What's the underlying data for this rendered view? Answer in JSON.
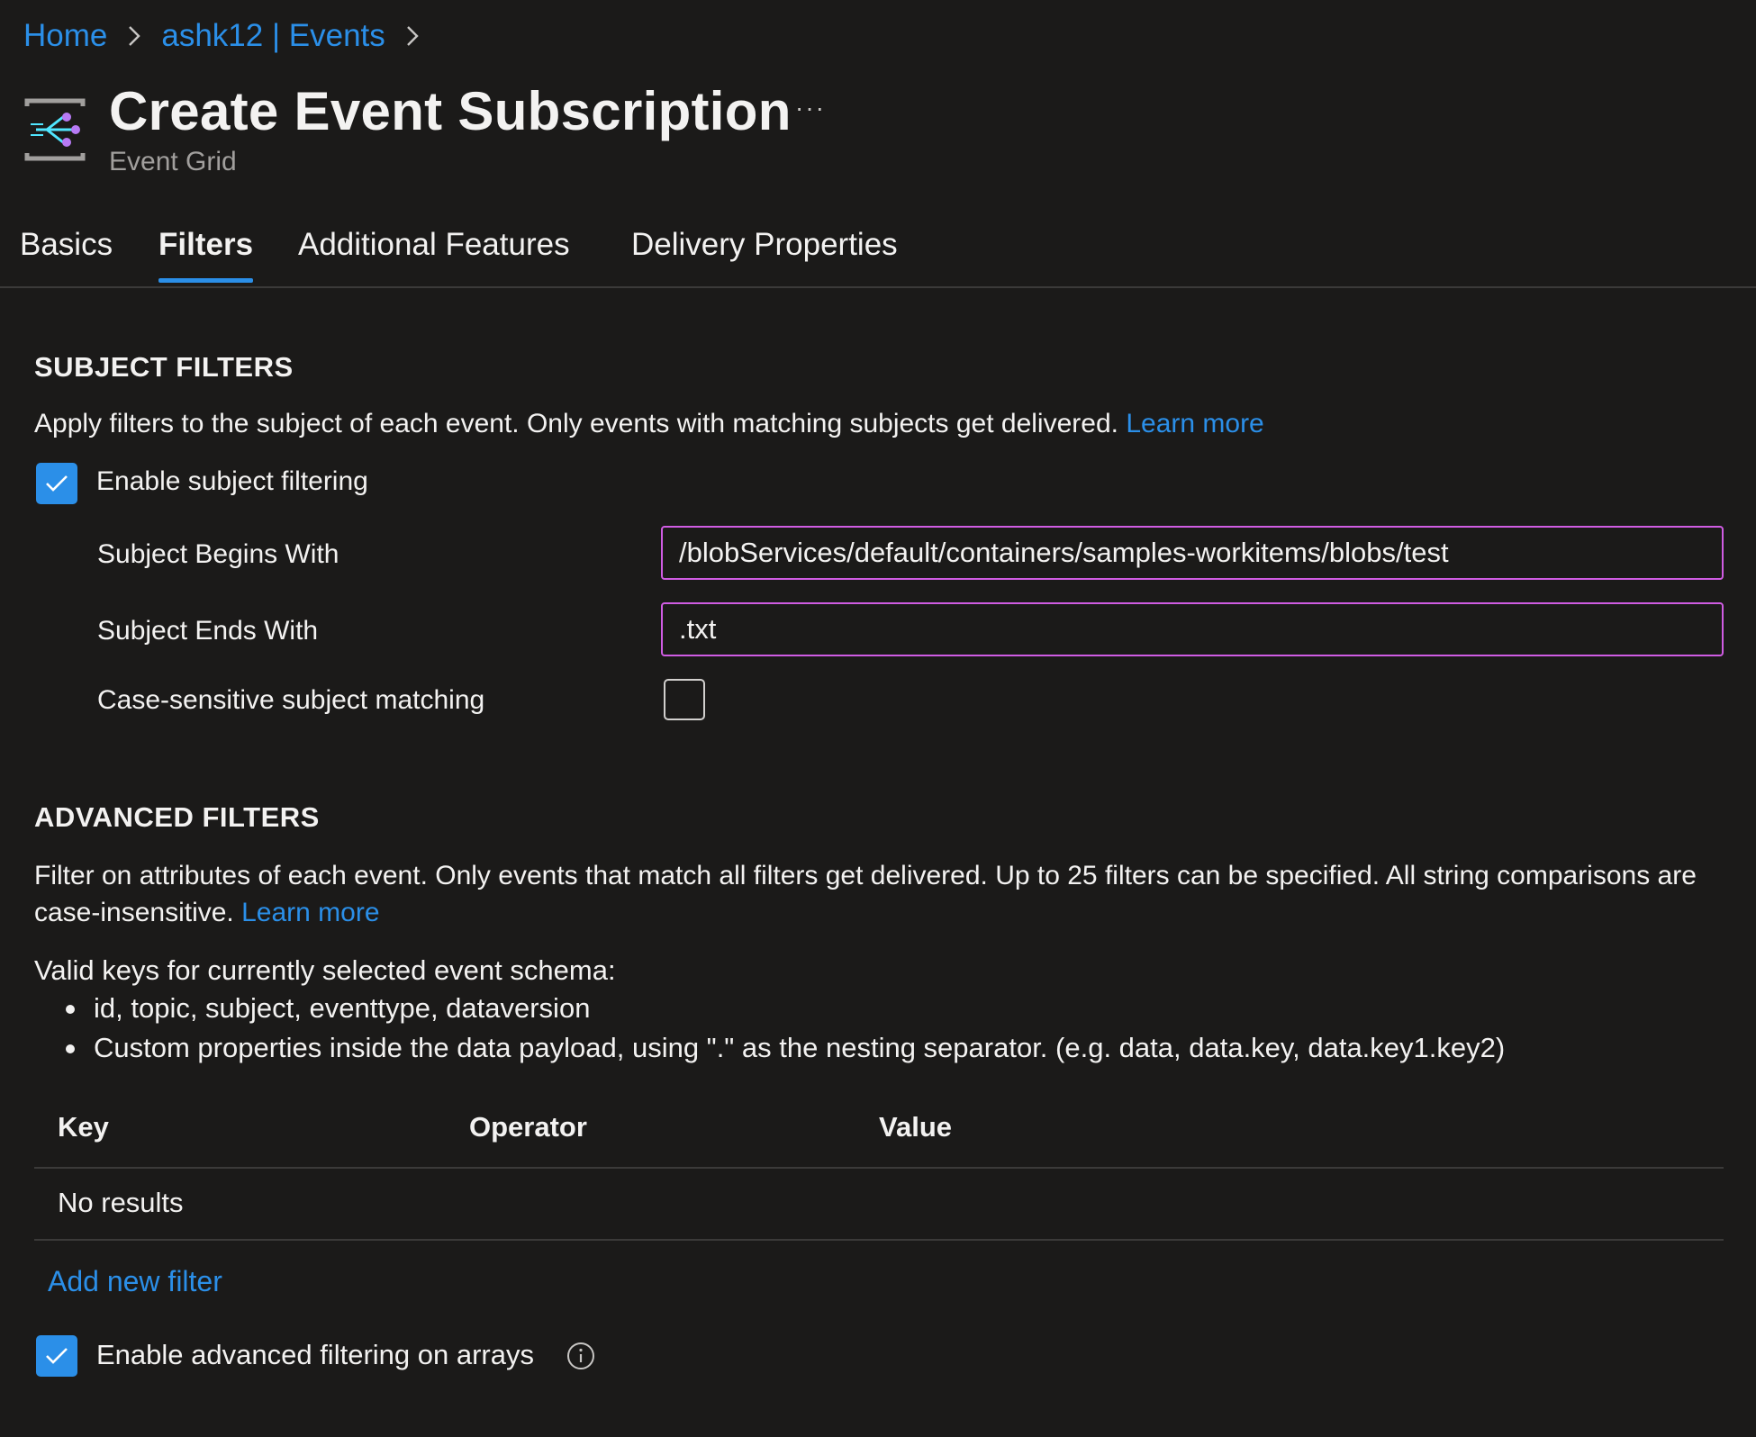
{
  "breadcrumb": {
    "items": [
      "Home",
      "ashk12 | Events"
    ]
  },
  "header": {
    "title": "Create Event Subscription",
    "subtitle": "Event Grid",
    "more": "···"
  },
  "tabs": [
    {
      "label": "Basics",
      "active": false
    },
    {
      "label": "Filters",
      "active": true
    },
    {
      "label": "Additional Features",
      "active": false
    },
    {
      "label": "Delivery Properties",
      "active": false
    }
  ],
  "subject_filters": {
    "heading": "SUBJECT FILTERS",
    "description": "Apply filters to the subject of each event. Only events with matching subjects get delivered.",
    "learn_more": "Learn more",
    "enable_label": "Enable subject filtering",
    "enable_checked": true,
    "begins_with_label": "Subject Begins With",
    "begins_with_value": "/blobServices/default/containers/samples-workitems/blobs/test",
    "ends_with_label": "Subject Ends With",
    "ends_with_value": ".txt",
    "case_sensitive_label": "Case-sensitive subject matching",
    "case_sensitive_checked": false
  },
  "advanced_filters": {
    "heading": "ADVANCED FILTERS",
    "description_line1": "Filter on attributes of each event. Only events that match all filters get delivered. Up to 25 filters can be specified. All string comparisons are",
    "description_line2": "case-insensitive.",
    "learn_more": "Learn more",
    "valid_keys_title": "Valid keys for currently selected event schema:",
    "valid_keys": [
      "id, topic, subject, eventtype, dataversion",
      "Custom properties inside the data payload, using \".\" as the nesting separator. (e.g. data, data.key, data.key1.key2)"
    ],
    "table": {
      "columns": [
        "Key",
        "Operator",
        "Value"
      ],
      "empty_text": "No results"
    },
    "add_filter": "Add new filter",
    "arrays_label": "Enable advanced filtering on arrays",
    "arrays_checked": true
  },
  "colors": {
    "background": "#1b1a19",
    "accent": "#2b8fe8",
    "input_border": "#d05ce3",
    "muted_text": "#a19f9d"
  }
}
